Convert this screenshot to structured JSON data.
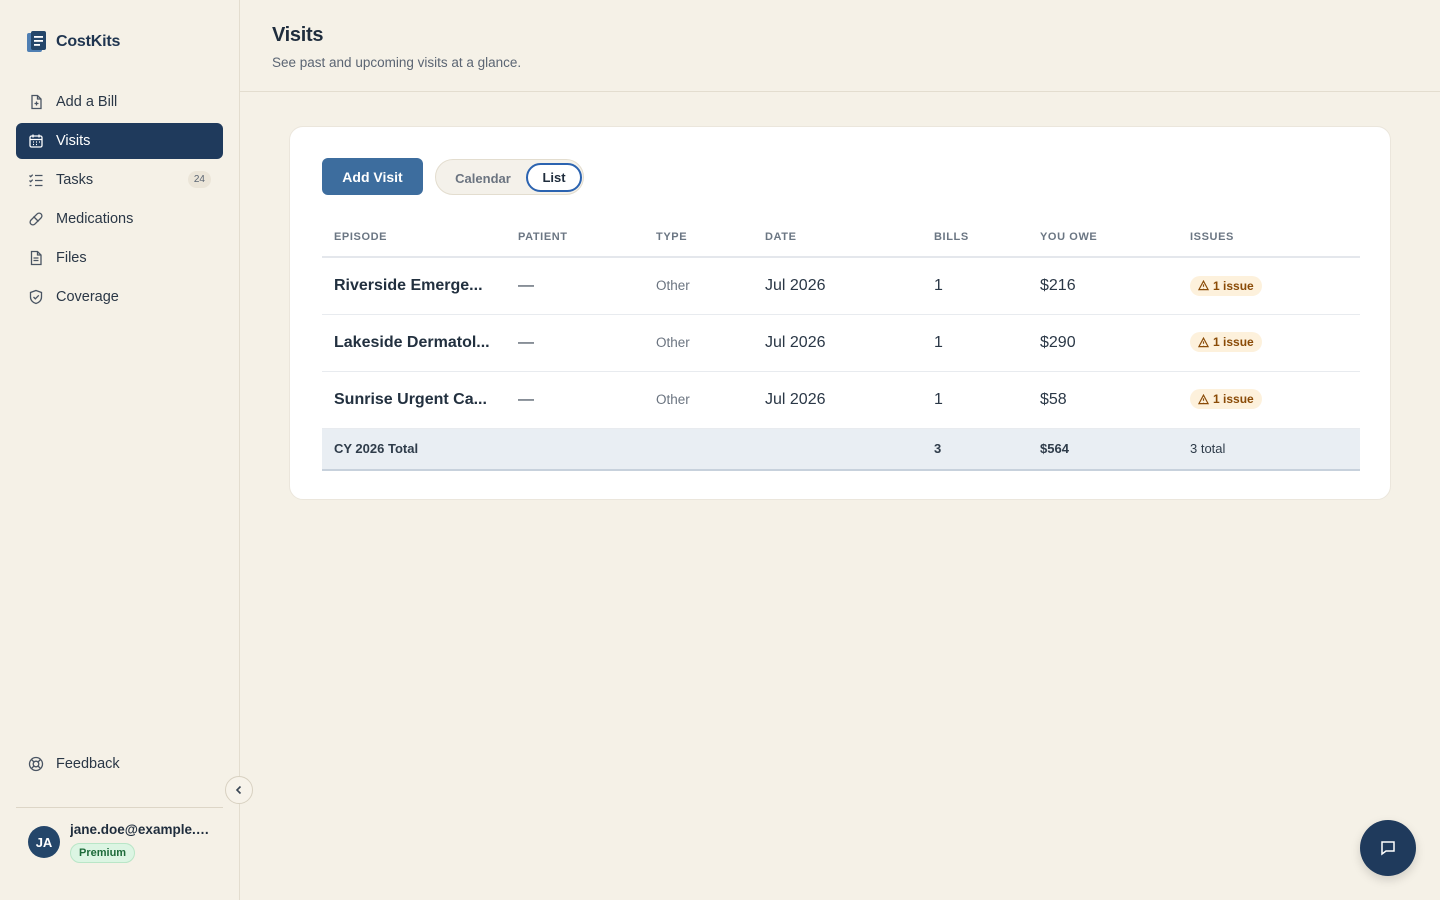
{
  "brand": {
    "name": "CostKits"
  },
  "sidebar": {
    "items": [
      {
        "label": "Add a Bill",
        "icon": "file-plus-icon"
      },
      {
        "label": "Visits",
        "icon": "calendar-icon",
        "active": true
      },
      {
        "label": "Tasks",
        "icon": "checklist-icon",
        "badge": "24"
      },
      {
        "label": "Medications",
        "icon": "pill-icon"
      },
      {
        "label": "Files",
        "icon": "file-icon"
      },
      {
        "label": "Coverage",
        "icon": "shield-check-icon"
      }
    ],
    "feedback": {
      "label": "Feedback",
      "icon": "lifebuoy-icon"
    }
  },
  "user": {
    "initials": "JA",
    "email": "jane.doe@example.com",
    "plan": "Premium"
  },
  "header": {
    "title": "Visits",
    "subtitle": "See past and upcoming visits at a glance."
  },
  "toolbar": {
    "add_label": "Add Visit",
    "view_calendar": "Calendar",
    "view_list": "List",
    "active_view": "List"
  },
  "table": {
    "columns": [
      "EPISODE",
      "PATIENT",
      "TYPE",
      "DATE",
      "BILLS",
      "YOU OWE",
      "ISSUES"
    ],
    "rows": [
      {
        "episode": "Riverside Emerge...",
        "patient": "—",
        "type": "Other",
        "date": "Jul 2026",
        "bills": "1",
        "owe": "$216",
        "issues": "1 issue"
      },
      {
        "episode": "Lakeside Dermatol...",
        "patient": "—",
        "type": "Other",
        "date": "Jul 2026",
        "bills": "1",
        "owe": "$290",
        "issues": "1 issue"
      },
      {
        "episode": "Sunrise Urgent Ca...",
        "patient": "—",
        "type": "Other",
        "date": "Jul 2026",
        "bills": "1",
        "owe": "$58",
        "issues": "1 issue"
      }
    ],
    "total": {
      "label": "CY 2026 Total",
      "bills": "3",
      "owe": "$564",
      "issues": "3 total"
    }
  },
  "colors": {
    "accent": "#1f3a5c",
    "button": "#3d6d9e",
    "background": "#f5f1e7",
    "issue_bg": "#fdf1dc",
    "issue_text": "#8a4b07"
  }
}
